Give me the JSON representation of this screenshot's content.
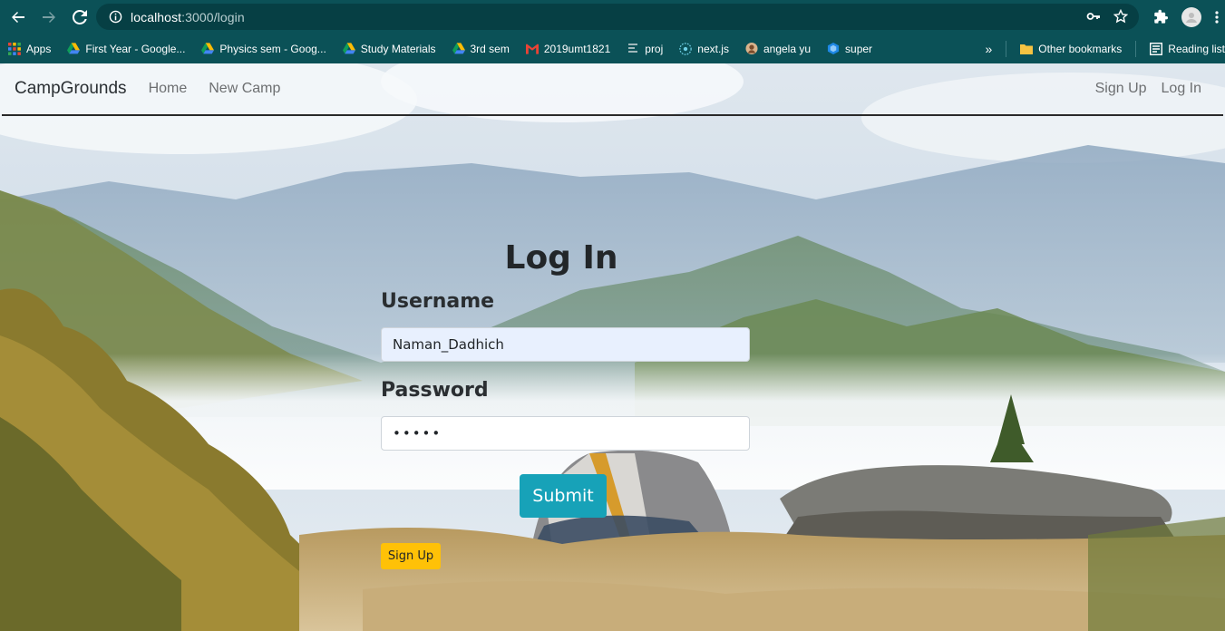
{
  "browser": {
    "url_host": "localhost",
    "url_path": ":3000/login",
    "bookmarks": [
      {
        "label": "Apps",
        "icon": "apps-grid-icon"
      },
      {
        "label": "First Year - Google...",
        "icon": "google-drive-icon"
      },
      {
        "label": "Physics sem - Goog...",
        "icon": "google-drive-icon"
      },
      {
        "label": "Study Materials",
        "icon": "google-drive-icon"
      },
      {
        "label": "3rd sem",
        "icon": "google-drive-icon"
      },
      {
        "label": "2019umt1821",
        "icon": "gmail-icon"
      },
      {
        "label": "proj",
        "icon": "proj-icon"
      },
      {
        "label": "next.js",
        "icon": "nextjs-icon"
      },
      {
        "label": "angela yu",
        "icon": "angela-icon"
      },
      {
        "label": "super",
        "icon": "super-icon"
      }
    ],
    "overflow": "»",
    "other_bookmarks": "Other bookmarks",
    "reading_list": "Reading list"
  },
  "navbar": {
    "brand": "CampGrounds",
    "links": [
      "Home",
      "New Camp"
    ],
    "right_links": [
      "Sign Up",
      "Log In"
    ]
  },
  "login": {
    "title": "Log In",
    "username_label": "Username",
    "username_value": "Naman_Dadhich",
    "password_label": "Password",
    "password_value": "•••••",
    "submit_label": "Submit",
    "signup_label": "Sign Up"
  },
  "colors": {
    "chrome": "#0b5157",
    "submit": "#17a2b8",
    "signup": "#ffc107",
    "autofill": "#e8f0fe"
  }
}
